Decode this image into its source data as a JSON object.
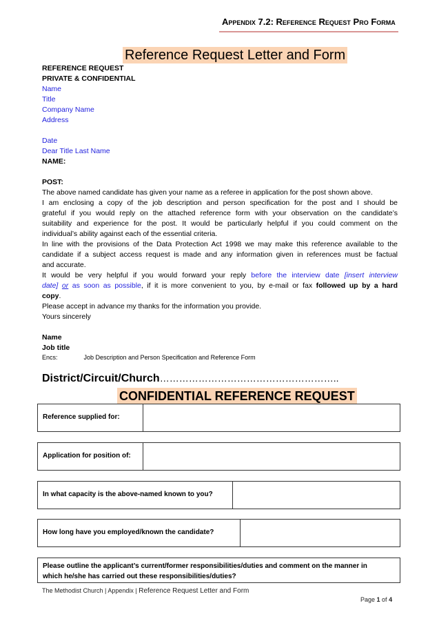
{
  "header": {
    "appendix_title": "Appendix 7.2: Reference Request Pro Forma",
    "rule_color": "#d99594"
  },
  "title": {
    "text": "Reference Request Letter and Form",
    "highlight_color": "#fbd4b4"
  },
  "letter": {
    "heading1": "REFERENCE  REQUEST",
    "heading2": "PRIVATE & CONFIDENTIAL",
    "address_fields": [
      "Name",
      "Title",
      "Company Name",
      "Address"
    ],
    "date_field": "Date",
    "salutation": "Dear Title Last Name",
    "name_label": "NAME:",
    "post_label": "POST:",
    "para1": "The above named candidate has given your name as a referee in application for the post shown above.",
    "para2_lines": [
      "I am enclosing a copy of the job description and person specification for the post and I should be",
      "grateful if you would reply on the attached reference form with your observation on the candidate’s",
      "suitability and experience for the post.  It would be particularly helpful if you could comment on the",
      "individual’s ability against each of the essential criteria."
    ],
    "para3_lines": [
      "In line with the provisions of the Data Protection Act 1998 we may make this reference available to the",
      "candidate if a subject access request is made and any information given in references must be factual",
      "and accurate."
    ],
    "para4": {
      "part1": "It would be very helpful if you would forward your reply ",
      "part2_blue": "before the interview date ",
      "part3_blue_italic": "[insert interview",
      "part4_blue_italic": "date]",
      "part5_blue_italic_underline": "or",
      "part6_blue": "as soon as possible",
      "part7": ", if it is more convenient to you, by e-mail or fax ",
      "part8_bold": "followed up by a hard",
      "part9_bold": "copy",
      "part10": "."
    },
    "para5": "Please accept in advance my thanks for the information you provide.",
    "closing": "Yours sincerely",
    "sign_name": "Name",
    "sign_job": "Job title",
    "encs_label": "Encs:",
    "encs_text": "Job Description and Person Specification and Reference Form",
    "link_color": "#1f1fdd"
  },
  "form": {
    "district_label": "District/Circuit/Church",
    "district_dots": "………………………………………………..",
    "confidential_title": "CONFIDENTIAL REFERENCE REQUEST",
    "fields": [
      {
        "label": "Reference supplied for:",
        "value": ""
      },
      {
        "label": "Application for position of:",
        "value": ""
      },
      {
        "label": "In what capacity is the above-named known to you?",
        "value": ""
      },
      {
        "label": "How long have you employed/known the candidate?",
        "value": ""
      }
    ],
    "outline_question_lines": [
      "Please outline the applicant’s current/former responsibilities/duties and comment on the manner in",
      "which he/she has carried out these responsibilities/duties?"
    ]
  },
  "footer": {
    "left_text": "The Methodist Church | Appendix | ",
    "doc_title": "Reference  Request Letter and Form",
    "page_prefix": "Page ",
    "page_current": "1",
    "page_of": " of ",
    "page_total": "4"
  }
}
